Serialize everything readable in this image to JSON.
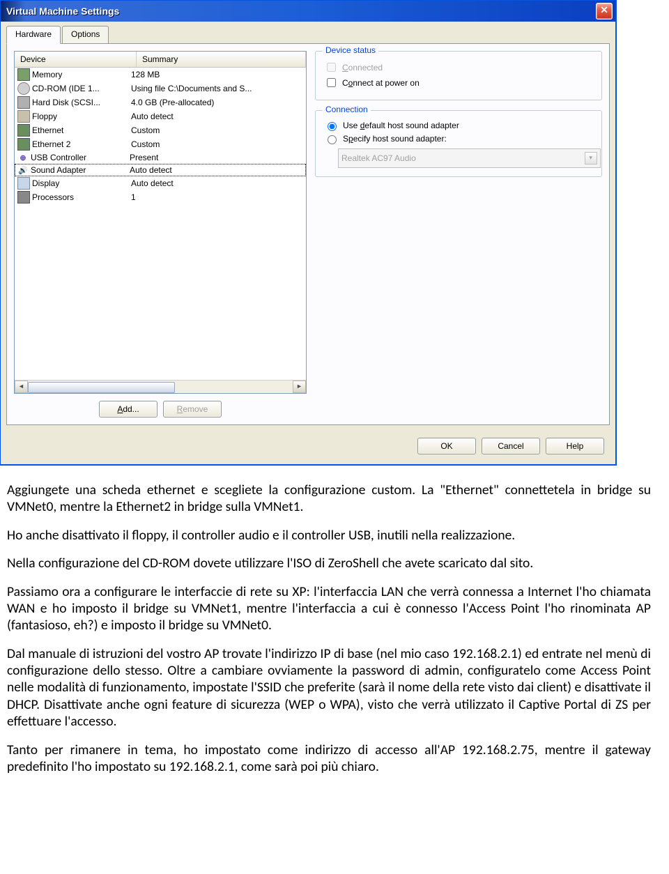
{
  "dialog": {
    "title": "Virtual Machine Settings",
    "tabs": {
      "hardware": "Hardware",
      "options": "Options"
    },
    "columns": {
      "device": "Device",
      "summary": "Summary"
    },
    "devices": [
      {
        "icon": "memory-icon",
        "name": "Memory",
        "summary": "128 MB"
      },
      {
        "icon": "cdrom-icon",
        "name": "CD-ROM (IDE 1...",
        "summary": "Using file C:\\Documents and S..."
      },
      {
        "icon": "harddisk-icon",
        "name": "Hard Disk (SCSI...",
        "summary": "4.0 GB (Pre-allocated)"
      },
      {
        "icon": "floppy-icon",
        "name": "Floppy",
        "summary": "Auto detect"
      },
      {
        "icon": "ethernet-icon",
        "name": "Ethernet",
        "summary": "Custom"
      },
      {
        "icon": "ethernet-icon",
        "name": "Ethernet 2",
        "summary": "Custom"
      },
      {
        "icon": "usb-icon",
        "name": "USB Controller",
        "summary": "Present"
      },
      {
        "icon": "sound-icon",
        "name": "Sound Adapter",
        "summary": "Auto detect",
        "selected": true
      },
      {
        "icon": "display-icon",
        "name": "Display",
        "summary": "Auto detect"
      },
      {
        "icon": "cpu-icon",
        "name": "Processors",
        "summary": "1"
      }
    ],
    "buttons": {
      "add": "Add...",
      "remove": "Remove",
      "ok": "OK",
      "cancel": "Cancel",
      "help": "Help"
    },
    "status_group": {
      "legend": "Device status",
      "connected": "Connected",
      "connect_on_power": "Connect at power on"
    },
    "connection_group": {
      "legend": "Connection",
      "use_default_prefix": "Use ",
      "use_default_ul": "d",
      "use_default_suffix": "efault host sound adapter",
      "specify_prefix": "S",
      "specify_ul": "p",
      "specify_suffix": "ecify host sound adapter:",
      "combo_value": "Realtek AC97 Audio"
    }
  },
  "doc": {
    "p1": "Aggiungete una scheda ethernet e scegliete la configurazione custom. La \"Ethernet\" connettetela in bridge su VMNet0, mentre la Ethernet2 in bridge sulla VMNet1.",
    "p2": "Ho anche disattivato il floppy, il controller audio e il controller USB, inutili nella realizzazione.",
    "p3": "Nella configurazione del CD-ROM dovete utilizzare l'ISO di ZeroShell che avete scaricato dal sito.",
    "p4": "Passiamo ora a configurare le interfaccie di rete su XP: l'interfaccia LAN che verrà connessa a Internet l'ho chiamata WAN e ho imposto il bridge su VMNet1, mentre l'interfaccia a cui è connesso l'Access Point l'ho rinominata AP (fantasioso, eh?) e imposto il bridge su VMNet0.",
    "p5": "Dal manuale di istruzioni del vostro AP trovate l'indirizzo IP di base (nel mio caso 192.168.2.1) ed entrate nel menù di configurazione dello stesso. Oltre a cambiare ovviamente la password di admin, configuratelo come Access Point nelle modalità di funzionamento, impostate l'SSID che preferite (sarà il nome della rete visto dai client) e disattivate il DHCP. Disattivate anche ogni feature di sicurezza (WEP o WPA), visto che verrà utilizzato il Captive Portal di ZS per effettuare l'accesso.",
    "p6": "Tanto per rimanere in tema, ho impostato come indirizzo di accesso all'AP 192.168.2.75, mentre il gateway predefinito l'ho impostato su 192.168.2.1, come sarà poi più chiaro."
  }
}
